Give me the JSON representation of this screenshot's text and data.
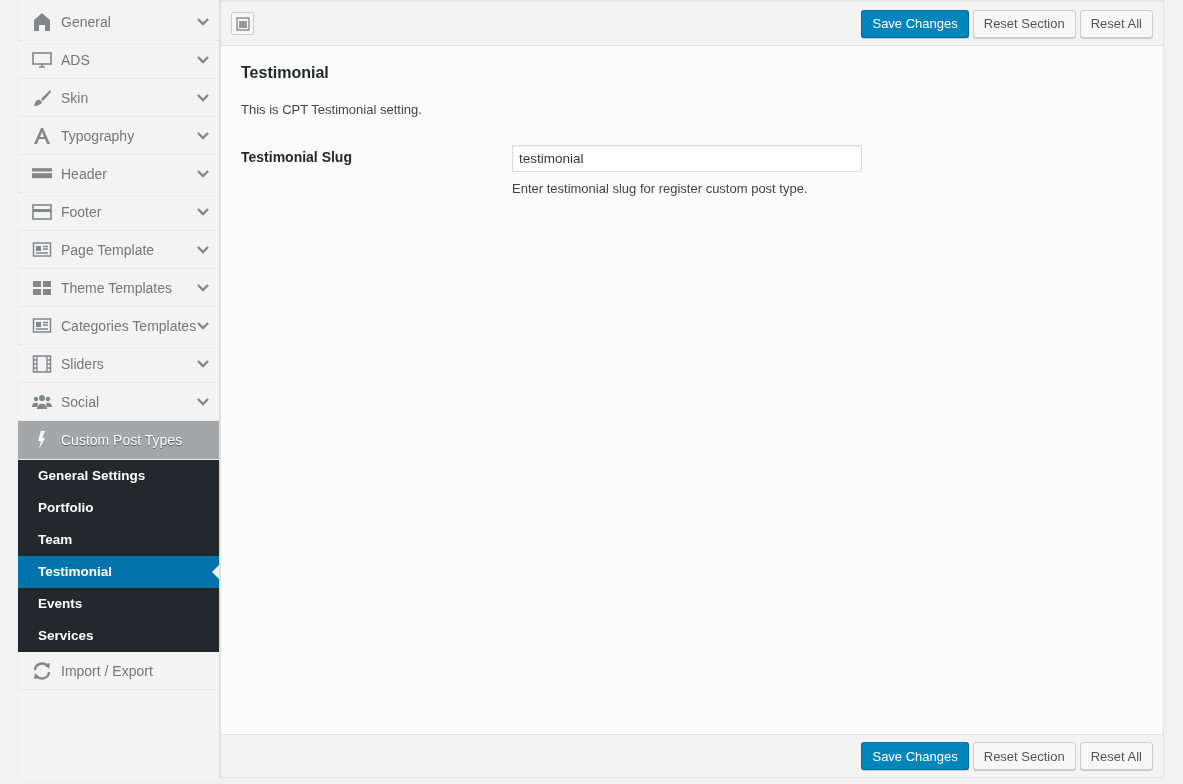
{
  "sidebar": {
    "items": [
      {
        "label": "General",
        "kind": "section",
        "selected": false,
        "expanded": false
      },
      {
        "label": "ADS",
        "kind": "section",
        "selected": false,
        "expanded": false
      },
      {
        "label": "Skin",
        "kind": "section",
        "selected": false,
        "expanded": false
      },
      {
        "label": "Typography",
        "kind": "section",
        "selected": false,
        "expanded": false
      },
      {
        "label": "Header",
        "kind": "section",
        "selected": false,
        "expanded": false
      },
      {
        "label": "Footer",
        "kind": "section",
        "selected": false,
        "expanded": false
      },
      {
        "label": "Page Template",
        "kind": "section",
        "selected": false,
        "expanded": false
      },
      {
        "label": "Theme Templates",
        "kind": "section",
        "selected": false,
        "expanded": false
      },
      {
        "label": "Categories Templates",
        "kind": "section",
        "selected": false,
        "expanded": false
      },
      {
        "label": "Sliders",
        "kind": "section",
        "selected": false,
        "expanded": false
      },
      {
        "label": "Social",
        "kind": "section",
        "selected": false,
        "expanded": false
      },
      {
        "label": "Custom Post Types",
        "kind": "section",
        "selected": true,
        "expanded": true,
        "children": [
          {
            "label": "General Settings",
            "selected": false
          },
          {
            "label": "Portfolio",
            "selected": false
          },
          {
            "label": "Team",
            "selected": false
          },
          {
            "label": "Testimonial",
            "selected": true
          },
          {
            "label": "Events",
            "selected": false
          },
          {
            "label": "Services",
            "selected": false
          }
        ]
      },
      {
        "label": "Import / Export",
        "kind": "link",
        "selected": false,
        "expanded": false
      }
    ]
  },
  "top_bar": {
    "buttons": [
      {
        "label": "Save Changes",
        "kind": "primary"
      },
      {
        "label": "Reset Section",
        "kind": "secondary"
      },
      {
        "label": "Reset All",
        "kind": "secondary"
      }
    ]
  },
  "section": {
    "title": "Testimonial",
    "description": "This is CPT Testimonial setting.",
    "fields": [
      {
        "label": "Testimonial Slug",
        "value": "testimonial",
        "help": "Enter testimonial slug for register custom post type."
      }
    ]
  },
  "bottom_bar": {
    "buttons": [
      {
        "label": "Save Changes",
        "kind": "primary"
      },
      {
        "label": "Reset Section",
        "kind": "secondary"
      },
      {
        "label": "Reset All",
        "kind": "secondary"
      }
    ]
  }
}
